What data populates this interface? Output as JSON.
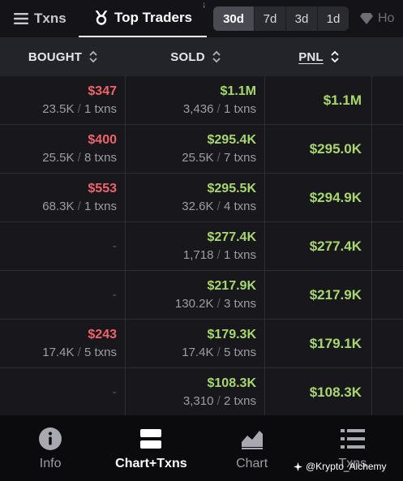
{
  "top_tabs": {
    "txns_label": "Txns",
    "traders_label": "Top Traders",
    "holders_label": "Ho"
  },
  "time_filters": [
    "30d",
    "7d",
    "3d",
    "1d"
  ],
  "active_time_filter": "30d",
  "columns": {
    "bought": "BOUGHT",
    "sold": "SOLD",
    "pnl": "PNL"
  },
  "rows": [
    {
      "bought_value": "$347",
      "bought_detail": [
        "23.5K",
        "1 txns"
      ],
      "sold_value": "$1.1M",
      "sold_detail": [
        "3,436",
        "1 txns"
      ],
      "pnl": "$1.1M"
    },
    {
      "bought_value": "$400",
      "bought_detail": [
        "25.5K",
        "8 txns"
      ],
      "sold_value": "$295.4K",
      "sold_detail": [
        "25.5K",
        "7 txns"
      ],
      "pnl": "$295.0K"
    },
    {
      "bought_value": "$553",
      "bought_detail": [
        "68.3K",
        "1 txns"
      ],
      "sold_value": "$295.5K",
      "sold_detail": [
        "32.6K",
        "4 txns"
      ],
      "pnl": "$294.9K"
    },
    {
      "bought_value": "-",
      "bought_detail": null,
      "sold_value": "$277.4K",
      "sold_detail": [
        "1,718",
        "1 txns"
      ],
      "pnl": "$277.4K"
    },
    {
      "bought_value": "-",
      "bought_detail": null,
      "sold_value": "$217.9K",
      "sold_detail": [
        "130.2K",
        "3 txns"
      ],
      "pnl": "$217.9K"
    },
    {
      "bought_value": "$243",
      "bought_detail": [
        "17.4K",
        "5 txns"
      ],
      "sold_value": "$179.3K",
      "sold_detail": [
        "17.4K",
        "5 txns"
      ],
      "pnl": "$179.1K"
    },
    {
      "bought_value": "-",
      "bought_detail": null,
      "sold_value": "$108.3K",
      "sold_detail": [
        "3,310",
        "2 txns"
      ],
      "pnl": "$108.3K"
    }
  ],
  "bottom_nav": [
    {
      "label": "Info",
      "icon": "info-icon"
    },
    {
      "label": "Chart+Txns",
      "icon": "chart-txns-icon"
    },
    {
      "label": "Chart",
      "icon": "chart-icon"
    },
    {
      "label": "Txns",
      "icon": "list-icon"
    }
  ],
  "active_bottom_nav": "Chart+Txns",
  "watermark": "@Krypto_Alchemy",
  "colors": {
    "positive": "#a8d86b",
    "negative": "#f0636b",
    "background": "#17171c",
    "header": "#23232a"
  }
}
